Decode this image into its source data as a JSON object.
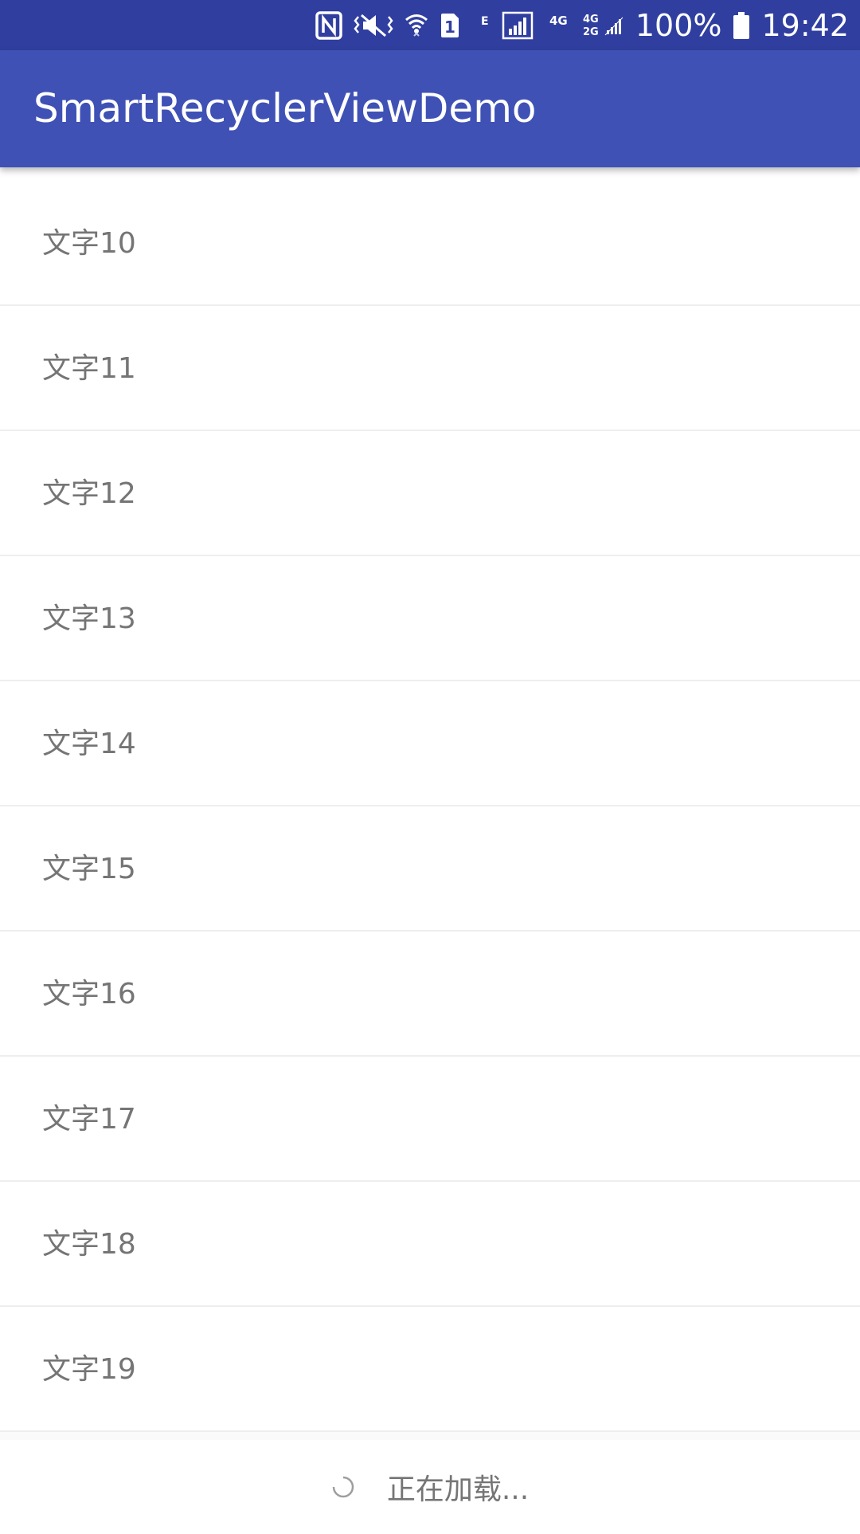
{
  "status_bar": {
    "icons": [
      "nfc-icon",
      "vibrate-icon",
      "wifi-icon",
      "sim-1-icon",
      "edge-network-icon",
      "signal-icon",
      "signal-4g-icon",
      "signal-4g-2g-icon"
    ],
    "network_e_label": "E",
    "network_4g_label": "4G",
    "network_4g2g_top": "4G",
    "network_4g2g_bottom": "2G",
    "sim_label": "1",
    "battery_percent": "100%",
    "time": "19:42",
    "background_color": "#303f9f"
  },
  "app_bar": {
    "title": "SmartRecyclerViewDemo",
    "background_color": "#3f51b5"
  },
  "list": {
    "items": [
      {
        "label": "文字10"
      },
      {
        "label": "文字11"
      },
      {
        "label": "文字12"
      },
      {
        "label": "文字13"
      },
      {
        "label": "文字14"
      },
      {
        "label": "文字15"
      },
      {
        "label": "文字16"
      },
      {
        "label": "文字17"
      },
      {
        "label": "文字18"
      },
      {
        "label": "文字19"
      }
    ]
  },
  "footer": {
    "loading_text": "正在加载...",
    "icon": "loading-spinner-icon"
  }
}
